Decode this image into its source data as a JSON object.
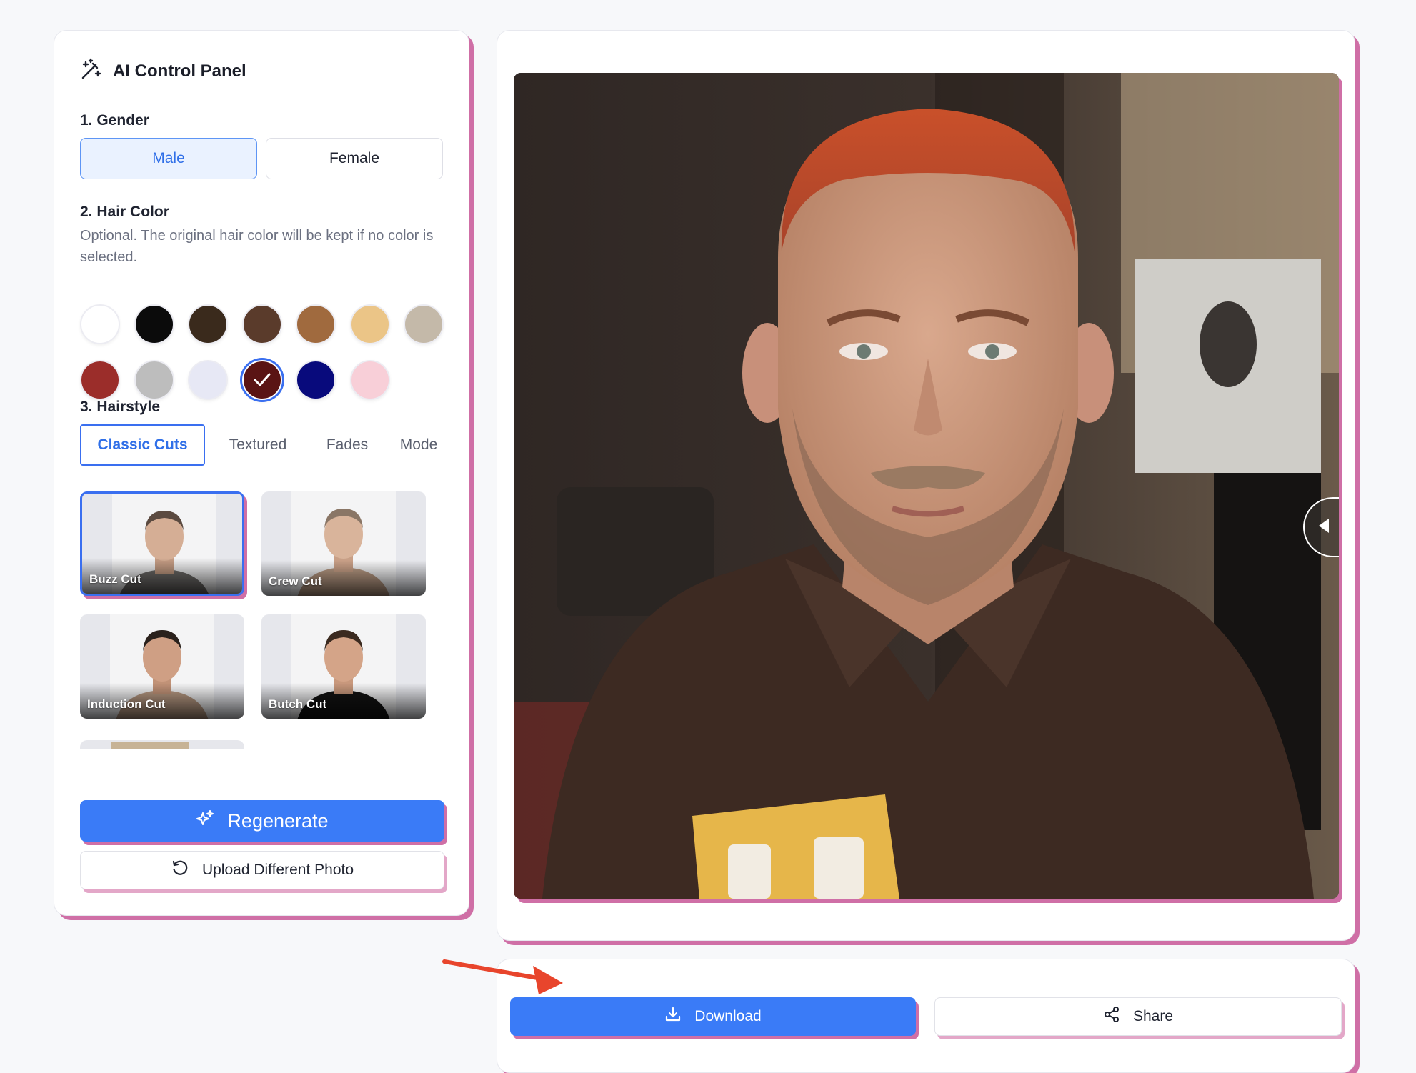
{
  "control_panel": {
    "title": "AI Control Panel",
    "icon": "magic-wand-icon",
    "gender": {
      "label": "1. Gender",
      "options": [
        "Male",
        "Female"
      ],
      "selected": "Male"
    },
    "hair_color": {
      "label": "2. Hair Color",
      "helper": "Optional. The original hair color will be kept if no color is selected.",
      "swatches": [
        "#ffffff",
        "#0b0b0b",
        "#3a2a1c",
        "#5a3b2b",
        "#a06a3e",
        "#ebc587",
        "#c4b9a9",
        "#9b2d2a",
        "#bdbdbd",
        "#e7e8f5",
        "#5a1414",
        "#080a7c",
        "#f8cfd8"
      ],
      "selected_swatch": "#5a1414"
    },
    "hairstyle": {
      "label": "3. Hairstyle",
      "tabs": [
        "Classic Cuts",
        "Textured",
        "Fades",
        "Mode"
      ],
      "active_tab": "Classic Cuts",
      "styles": [
        {
          "name": "Buzz Cut",
          "selected": true
        },
        {
          "name": "Crew Cut",
          "selected": false
        },
        {
          "name": "Induction Cut",
          "selected": false
        },
        {
          "name": "Butch Cut",
          "selected": false
        }
      ]
    },
    "regenerate_label": "Regenerate",
    "upload_label": "Upload Different Photo"
  },
  "result": {
    "download_label": "Download",
    "share_label": "Share"
  },
  "colors": {
    "accent": "#3a7bf7",
    "panel_shadow": "#cf6fa6",
    "annotation_arrow": "#e8452c"
  }
}
